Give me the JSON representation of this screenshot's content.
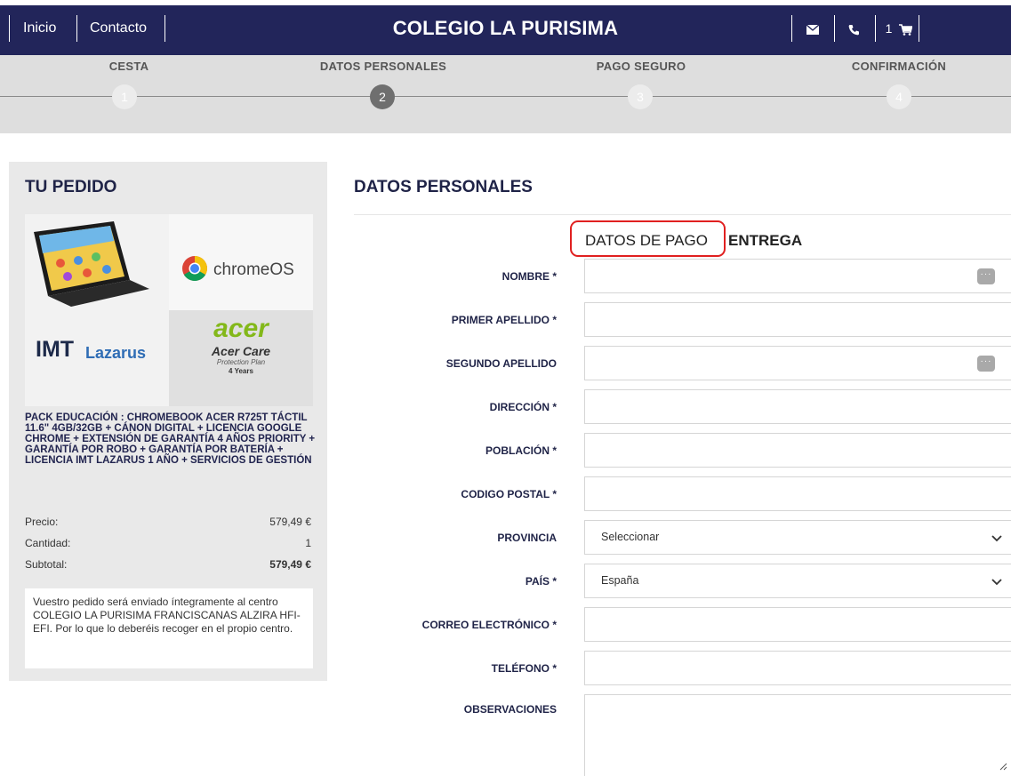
{
  "nav": {
    "home": "Inicio",
    "contact": "Contacto",
    "brand": "COLEGIO LA PURISIMA",
    "cart_count": "1"
  },
  "steps": [
    {
      "title": "CESTA",
      "number": "1"
    },
    {
      "title": "DATOS PERSONALES",
      "number": "2",
      "active": true
    },
    {
      "title": "PAGO SEGURO",
      "number": "3"
    },
    {
      "title": "CONFIRMACIÓN",
      "number": "4"
    }
  ],
  "order": {
    "title": "TU PEDIDO",
    "image_brands": {
      "chrome": "chromeOS",
      "imt": "IMT",
      "lazarus": "Lazarus",
      "acer": "acer",
      "care": "Acer Care",
      "plan": "Protection Plan",
      "years": "4 Years"
    },
    "product_name": "PACK EDUCACIÓN : CHROMEBOOK ACER R725T TÁCTIL 11.6\" 4GB/32GB + CÁNON DIGITAL + LICENCIA GOOGLE CHROME + EXTENSIÓN DE GARANTÍA 4 AÑOS PRIORITY + GARANTÍA POR ROBO + GARANTÍA POR BATERÍA + LICENCIA IMT LAZARUS 1 AÑO + SERVICIOS DE GESTIÓN",
    "price_label": "Precio:",
    "price": "579,49 €",
    "qty_label": "Cantidad:",
    "qty": "1",
    "subtotal_label": "Subtotal:",
    "subtotal": "579,49 €",
    "notice": "Vuestro pedido será enviado íntegramente al centro COLEGIO LA PURISIMA FRANCISCANAS ALZIRA HFI-EFI. Por lo que lo deberéis recoger en el propio centro."
  },
  "main": {
    "title": "DATOS PERSONALES",
    "tab_payment": "DATOS DE PAGO",
    "tab_delivery": "ENTREGA",
    "fields": [
      {
        "label": "NOMBRE *",
        "value": ""
      },
      {
        "label": "PRIMER APELLIDO *",
        "value": ""
      },
      {
        "label": "SEGUNDO APELLIDO",
        "value": ""
      },
      {
        "label": "DIRECCIÓN *",
        "value": ""
      },
      {
        "label": "POBLACIÓN *",
        "value": ""
      },
      {
        "label": "CODIGO POSTAL *",
        "value": ""
      },
      {
        "label": "PROVINCIA",
        "value": "Seleccionar"
      },
      {
        "label": "PAÍS *",
        "value": "España"
      },
      {
        "label": "CORREO ELECTRÓNICO *",
        "value": ""
      },
      {
        "label": "TELÉFONO *",
        "value": ""
      },
      {
        "label": "OBSERVACIONES",
        "value": ""
      }
    ]
  },
  "icons": {
    "mail": "envelope-icon",
    "phone": "phone-icon",
    "cart": "cart-icon",
    "dots": "autofill-dots-icon",
    "chevron": "chevron-down-icon",
    "resize": "resize-grip-icon"
  }
}
